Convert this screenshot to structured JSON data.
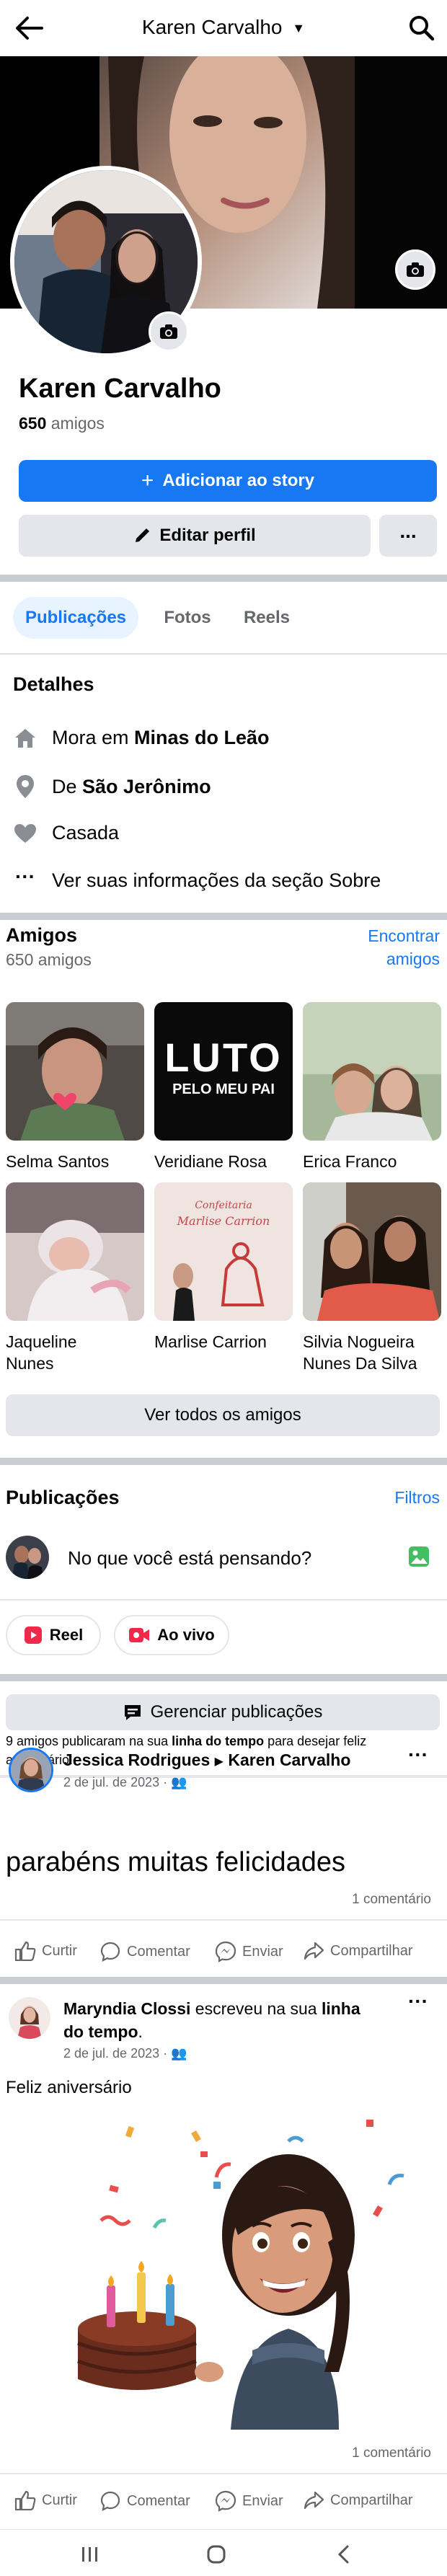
{
  "topbar": {
    "title": "Karen Carvalho"
  },
  "profile": {
    "name": "Karen Carvalho",
    "friends_count": "650",
    "friends_word": "amigos"
  },
  "buttons": {
    "add_story": "Adicionar ao story",
    "edit_profile": "Editar perfil",
    "more": "..."
  },
  "tabs": [
    "Publicações",
    "Fotos",
    "Reels"
  ],
  "details": {
    "heading": "Detalhes",
    "lives_prefix": "Mora em ",
    "lives_city": "Minas do Leão",
    "from_prefix": "De ",
    "from_city": "São Jerônimo",
    "relationship": "Casada",
    "see_about": "Ver suas informações da seção Sobre"
  },
  "friends": {
    "heading": "Amigos",
    "count": "650 amigos",
    "find_line1": "Encontrar",
    "find_line2": "amigos",
    "items": [
      {
        "name": "Selma Santos"
      },
      {
        "name": "Veridiane Rosa",
        "photo_text_1": "LUTO",
        "photo_text_2": "PELO MEU PAI"
      },
      {
        "name": "Erica Franco"
      },
      {
        "name_1": "Jaqueline",
        "name_2": "Nunes"
      },
      {
        "name": "Marlise Carrion",
        "photo_text_1": "Confeitaria",
        "photo_text_2": "Marlise Carrion"
      },
      {
        "name_1": "Silvia Nogueira",
        "name_2": "Nunes Da Silva"
      }
    ],
    "see_all": "Ver todos os amigos"
  },
  "posts_section": {
    "heading": "Publicações",
    "filters": "Filtros",
    "composer_placeholder": "No que você está pensando?",
    "reel": "Reel",
    "live": "Ao vivo",
    "manage": "Gerenciar publicações",
    "birthday_note_1": "9 amigos publicaram na sua ",
    "birthday_note_bold": "linha do tempo",
    "birthday_note_2": " para desejar feliz",
    "birthday_note_3": "aniversário."
  },
  "post1": {
    "author": "Jessica Rodrigues",
    "arrow": "▶",
    "target": "Karen Carvalho",
    "date": "2 de jul. de 2023 · ",
    "text": "parabéns muitas felicidades",
    "comments": "1 comentário"
  },
  "post2": {
    "author": "Maryndia Clossi",
    "middle": " escreveu na sua ",
    "bold_1": "linha",
    "bold_2": "do tempo",
    "dot": ".",
    "date": "2 de jul. de 2023 · ",
    "text": "Feliz aniversário",
    "comments": "1 comentário"
  },
  "actions": {
    "like": "Curtir",
    "comment": "Comentar",
    "send": "Enviar",
    "share": "Compartilhar"
  },
  "colors": {
    "accent": "#1877f2",
    "button_gray": "#e4e6eb",
    "separator": "#c9ccd1",
    "text_secondary": "#65676b"
  }
}
